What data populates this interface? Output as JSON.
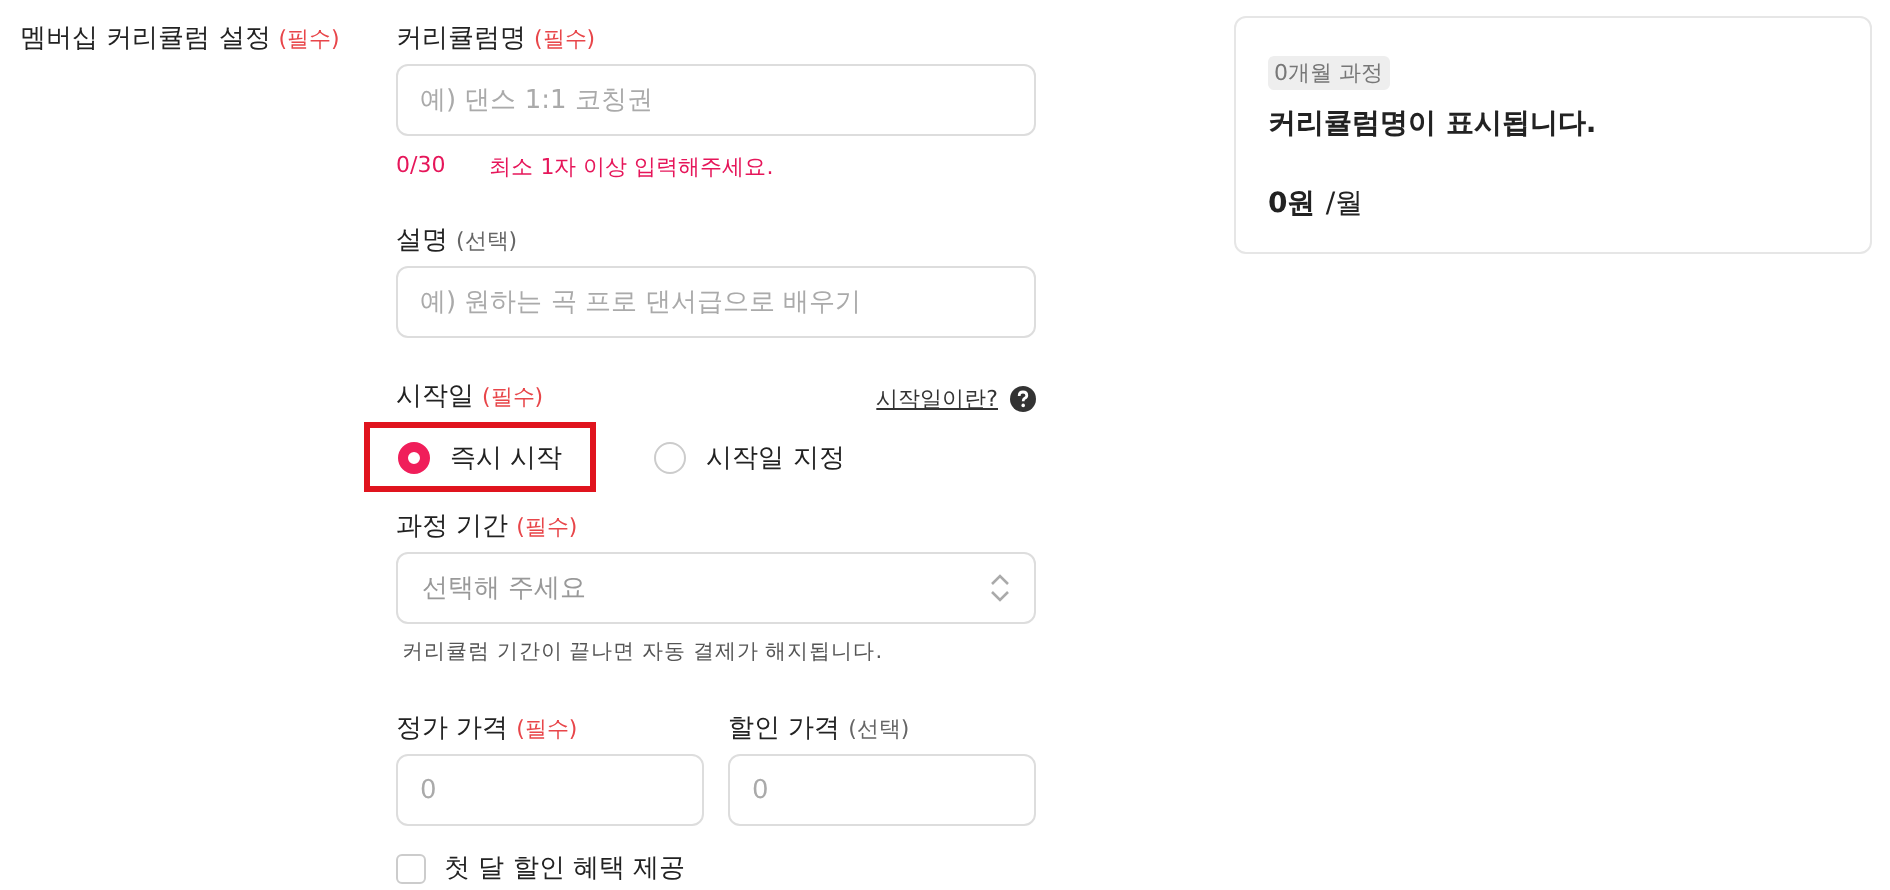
{
  "section": {
    "label": "멤버십 커리큘럼 설정",
    "tag": {
      "text": "(필수)",
      "kind": "required"
    }
  },
  "name_field": {
    "label": "커리큘럼명",
    "tag": {
      "text": "(필수)",
      "kind": "required"
    },
    "placeholder": "예) 댄스 1:1 코칭권",
    "counter": "0/30",
    "error": "최소 1자 이상 입력해주세요."
  },
  "description_field": {
    "label": "설명",
    "tag": {
      "text": "(선택)",
      "kind": "optional"
    },
    "placeholder": "예) 원하는 곡 프로 댄서급으로 배우기"
  },
  "start_date": {
    "label": "시작일",
    "tag": {
      "text": "(필수)",
      "kind": "required"
    },
    "help_link": "시작일이란?",
    "options": [
      {
        "label": "즉시 시작",
        "selected": true,
        "highlighted": true
      },
      {
        "label": "시작일 지정",
        "selected": false,
        "highlighted": false
      }
    ]
  },
  "duration": {
    "label": "과정 기간",
    "tag": {
      "text": "(필수)",
      "kind": "required"
    },
    "placeholder": "선택해 주세요",
    "hint": "커리큘럼 기간이 끝나면 자동 결제가 해지됩니다."
  },
  "prices": [
    {
      "label": "정가 가격",
      "tag": {
        "text": "(필수)",
        "kind": "required"
      },
      "placeholder": "0"
    },
    {
      "label": "할인 가격",
      "tag": {
        "text": "(선택)",
        "kind": "optional"
      },
      "placeholder": "0"
    }
  ],
  "first_month_discount": {
    "label": "첫 달 할인 혜택 제공",
    "checked": false
  },
  "preview": {
    "badge": "0개월 과정",
    "title": "커리큘럼명이 표시됩니다.",
    "price": "0원",
    "unit": "/월"
  }
}
